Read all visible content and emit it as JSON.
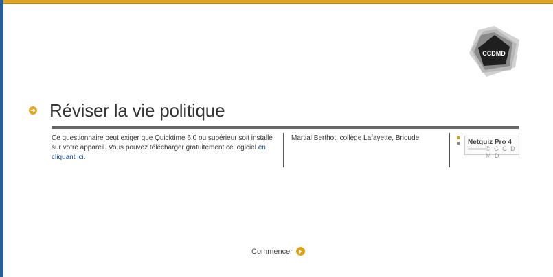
{
  "header": {
    "title": "Réviser la vie politique",
    "logo_text": "CCDMD"
  },
  "info": {
    "requirement_text": "Ce questionnaire peut exiger que Quicktime 6.0 ou supérieur soit installé sur votre appareil. Vous pouvez télécharger gratuitement ce logiciel ",
    "download_link": "en cliquant ici",
    "requirement_end": ".",
    "author": "Martial Berthot, collège Lafayette, Brioude"
  },
  "badge": {
    "title": "Netquiz Pro 4",
    "copyright": "© C C D M D"
  },
  "footer": {
    "start_label": "Commencer"
  },
  "icons": {
    "title_bullet": "arrow-right-circle-icon",
    "start": "play-circle-icon"
  },
  "colors": {
    "accent": "#e0a82a",
    "sidebar": "#2b5d99",
    "link": "#1a4c8a",
    "rule": "#666666"
  }
}
